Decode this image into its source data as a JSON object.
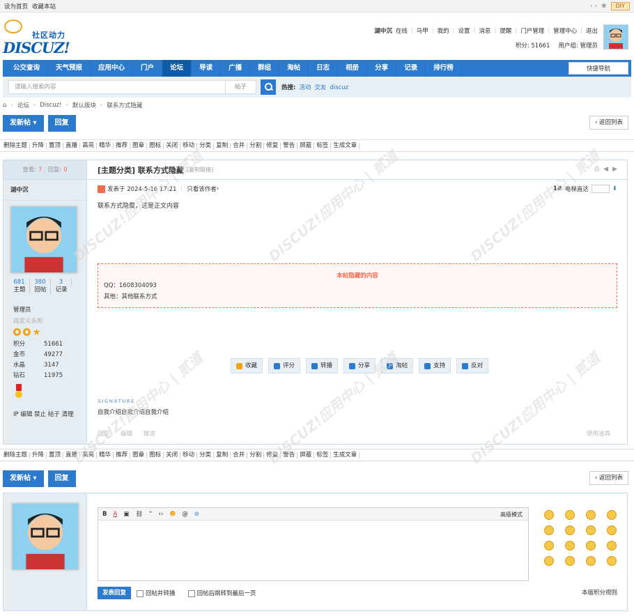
{
  "topbar": {
    "set_home": "设为首页",
    "bookmark": "收藏本站",
    "diy": "DIY"
  },
  "logo": {
    "sub": "社区动力",
    "main": "DISCUZ!"
  },
  "user": {
    "name": "湖中沉",
    "status": "在线",
    "items": [
      "马甲",
      "我的",
      "设置",
      "消息",
      "提醒",
      "门户管理",
      "管理中心",
      "退出"
    ],
    "points": "积分: 51661",
    "group": "用户组: 管理员"
  },
  "nav": {
    "items": [
      "公交查询",
      "天气预报",
      "应用中心",
      "门户",
      "论坛",
      "导读",
      "广播",
      "群组",
      "淘帖",
      "日志",
      "相册",
      "分享",
      "记录",
      "排行榜"
    ],
    "active": "论坛",
    "quick": "快捷导航"
  },
  "search": {
    "placeholder": "请输入搜索内容",
    "type": "帖子",
    "hot_label": "热搜:",
    "hot": [
      "活动",
      "交友",
      "discuz"
    ]
  },
  "breadcrumb": [
    "论坛",
    "Discuz!",
    "默认版块",
    "联系方式隐藏"
  ],
  "actions": {
    "new_post": "发新帖",
    "reply": "回复",
    "back": "返回列表"
  },
  "modtools": [
    "删除主题",
    "升降",
    "置顶",
    "直播",
    "高亮",
    "精华",
    "推荐",
    "图章",
    "图标",
    "关闭",
    "移动",
    "分类",
    "复制",
    "合并",
    "分割",
    "修复",
    "警告",
    "屏蔽",
    "标签",
    "生成文章"
  ],
  "thread": {
    "views_label": "查看:",
    "views": "7",
    "replies_label": "回复:",
    "replies": "0",
    "title": "[主题分类] 联系方式隐藏",
    "copy": "[复制链接]"
  },
  "author": {
    "name": "湖中沉",
    "threads": "681",
    "threads_label": "主题",
    "posts": "380",
    "posts_label": "回帖",
    "records": "3",
    "records_label": "记录",
    "role": "管理员",
    "custom": "自定义头衔",
    "credits": [
      [
        "积分",
        "51661"
      ],
      [
        "金币",
        "49277"
      ],
      [
        "水晶",
        "3147"
      ],
      [
        "钻石",
        "11975"
      ]
    ],
    "ip": "IP 编辑 禁止 帖子 清理"
  },
  "post": {
    "meta": "发表于 2024-5-16 17:21",
    "only_author": "只看该作者",
    "floor": "1#",
    "goto": "电梯直达",
    "body": "联系方式隐藏，这是正文内容",
    "hidden_title": "本帖隐藏的内容",
    "hidden_lines": [
      "QQ：1608304093",
      "其他：其他联系方式"
    ],
    "buttons": [
      "收藏",
      "评分",
      "转播",
      "分享",
      "淘帖",
      "支持",
      "反对"
    ],
    "sig_label": "SIGNATURE",
    "sig": "自我介绍自我介绍自我介绍",
    "foot": [
      "回复",
      "编辑",
      "推送"
    ],
    "use_tool": "使用道具"
  },
  "editor": {
    "advanced": "高级模式",
    "submit": "发表回复",
    "opt1": "回帖并转播",
    "opt2": "回帖后跳转到最后一页",
    "rules": "本版积分规则"
  },
  "watermark": "DISCUZ!应用中心 | 贰道"
}
